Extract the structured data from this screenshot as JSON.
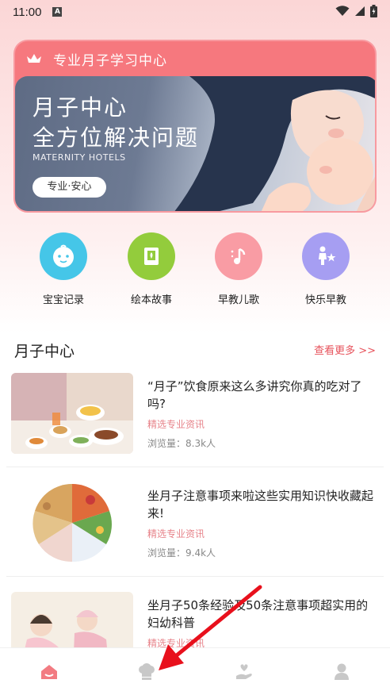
{
  "status_bar": {
    "time": "11:00",
    "notification_glyph": "A"
  },
  "banner": {
    "header": "专业月子学习中心",
    "title_line1": "月子中心",
    "title_line2": "全方位解决问题",
    "subtitle": "MATERNITY HOTELS",
    "pill": "专业·安心"
  },
  "quick_links": [
    {
      "label": "宝宝记录",
      "icon": "baby-face-icon",
      "color": "#45c6e8"
    },
    {
      "label": "绘本故事",
      "icon": "picture-book-icon",
      "color": "#93cc3c"
    },
    {
      "label": "早教儿歌",
      "icon": "music-note-icon",
      "color": "#f99ca4"
    },
    {
      "label": "快乐早教",
      "icon": "kid-star-icon",
      "color": "#a69ef2"
    }
  ],
  "section": {
    "title": "月子中心",
    "more": "查看更多 >>"
  },
  "articles": [
    {
      "title": "“月子”饮食原来这么多讲究你真的吃对了吗?",
      "tag": "精选专业资讯",
      "views": "浏览量：8.3k人"
    },
    {
      "title": "坐月子注意事项来啦这些实用知识快收藏起来!",
      "tag": "精选专业资讯",
      "views": "浏览量：9.4k人"
    },
    {
      "title": "坐月子50条经验及50条注意事项超实用的妇幼科普",
      "tag": "精选专业资讯",
      "views": ""
    }
  ],
  "bottom_nav": [
    {
      "icon": "home-icon",
      "active": true
    },
    {
      "icon": "chef-hat-icon",
      "active": false
    },
    {
      "icon": "care-hand-icon",
      "active": false
    },
    {
      "icon": "profile-icon",
      "active": false
    }
  ],
  "colors": {
    "accent": "#e7535c",
    "banner": "#f6787e",
    "annotation_arrow": "#e8101c"
  }
}
